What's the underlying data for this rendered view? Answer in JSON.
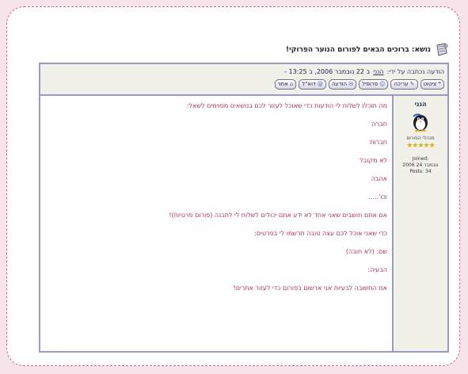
{
  "topic": {
    "icon": "topic-icon",
    "title": "נושא: ברוכים הבאים לפורום הנוער הפרוקי!"
  },
  "post": {
    "meta_prefix": "הודעה נכתבה על ידי:",
    "author_link": "הנני",
    "date": "ב 22 נובמבר 2006, ב 13:25 -",
    "buttons": [
      {
        "label": "ציטוט",
        "icon": "quote-icon"
      },
      {
        "label": "עריכה",
        "icon": "edit-icon"
      },
      {
        "label": "פרופיל",
        "icon": "profile-icon"
      },
      {
        "label": "הודעה",
        "icon": "pm-icon"
      },
      {
        "label": "דוא\"ל",
        "icon": "email-icon"
      },
      {
        "label": "אתר",
        "icon": "www-icon"
      }
    ]
  },
  "author": {
    "name": "הנני",
    "avatar": "penguin-icon",
    "rank": "מנהלי הפורום",
    "stars": "★★★★★",
    "joined": "Joined:",
    "joined_date": "2006 נובמבר 24",
    "posts": "Posts: 34"
  },
  "body": {
    "lines": [
      "מה תוכלו לשלוח לי הודעות כדי שאוכל לעזור לכם בנושאים מסוימים לשאל:",
      "חברה",
      "חברות",
      "לא מקובל",
      "אהבה",
      "וכו'.....",
      "אם אתם חושבים שאני אחד לא ידע אתם יכולים לשלוח לי לתכנה (פורום פרטיות)!",
      "כדי שאני אוכל לכם עצה טובה תרשמו לי בפרטים:",
      "שם: (לא חובה)",
      "הבעיה:",
      "את התשובה לבעיות אני ארשום בפורום כדי לעזור אחרים!"
    ]
  },
  "colors": {
    "accent": "#e0607e",
    "border": "#9a9ac8",
    "text": "#b0304c",
    "panel": "#f1f1ea"
  }
}
